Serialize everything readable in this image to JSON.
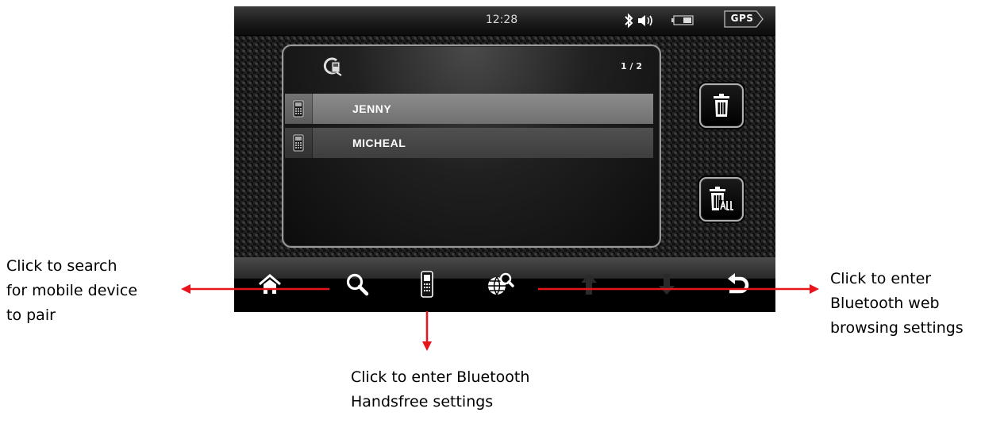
{
  "status_bar": {
    "time": "12:28",
    "gps_label": "GPS",
    "icons": [
      "bluetooth-icon",
      "speaker-icon",
      "battery-icon"
    ]
  },
  "device_list": {
    "page_indicator": "1 / 2",
    "header_icon": "bluetooth-phone-icon",
    "items": [
      {
        "name": "JENNY",
        "icon": "phone-icon",
        "selected": true
      },
      {
        "name": "MICHEAL",
        "icon": "phone-icon",
        "selected": false
      }
    ]
  },
  "side_buttons": [
    "delete-icon",
    "delete-all-icon"
  ],
  "bottom_nav": [
    "home-icon",
    "search-icon",
    "handsfree-icon",
    "web-settings-icon",
    "up-arrow-icon",
    "down-arrow-icon",
    "back-icon"
  ],
  "annotations": {
    "search": "Click to search\nfor mobile device\nto pair",
    "web": "Click to enter\nBluetooth web\nbrowsing settings",
    "handsfree": "Click to enter Bluetooth\nHandsfree settings"
  },
  "colors": {
    "arrow": "#e8141b",
    "selected_row": "#8a8a8a",
    "normal_row": "#4a4a4a"
  }
}
